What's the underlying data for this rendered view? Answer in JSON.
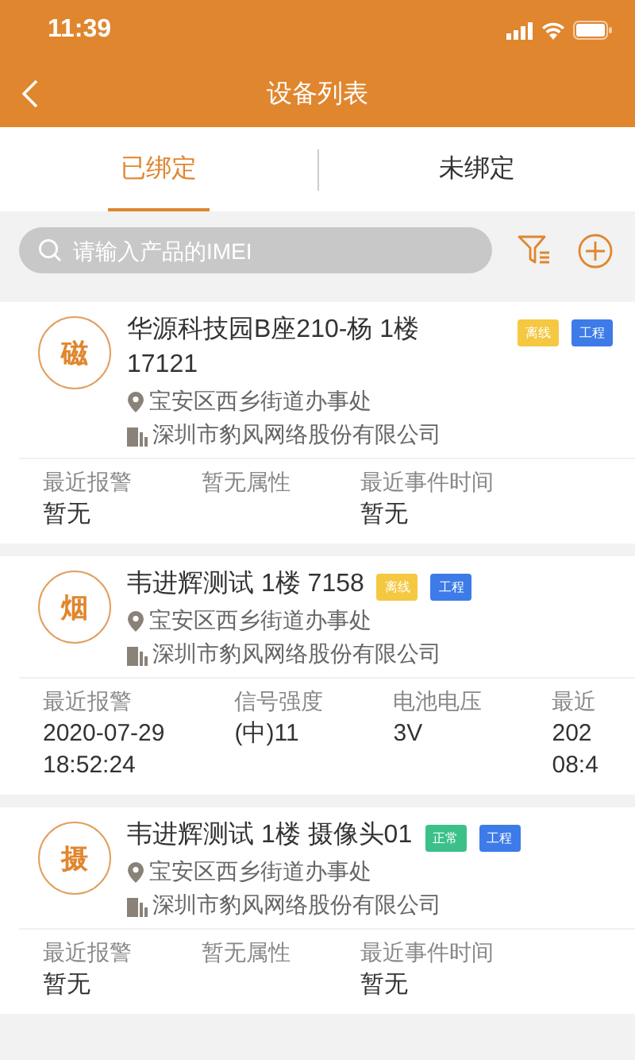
{
  "status_bar": {
    "time": "11:39"
  },
  "nav": {
    "title": "设备列表"
  },
  "tabs": [
    {
      "label": "已绑定",
      "selected": true
    },
    {
      "label": "未绑定",
      "selected": false
    }
  ],
  "search": {
    "placeholder": "请输入产品的IMEI"
  },
  "devices": [
    {
      "avatar": "磁",
      "name": "华源科技园B座210-杨 1楼 17121",
      "tags": [
        {
          "label": "离线",
          "color": "#f5c842"
        },
        {
          "label": "工程",
          "color": "#3d7be8"
        }
      ],
      "address": "宝安区西乡街道办事处",
      "company": "深圳市豹风网络股份有限公司",
      "stats": [
        {
          "label": "最近报警",
          "value": [
            "暂无"
          ]
        },
        {
          "label": "暂无属性"
        },
        {
          "label": "最近事件时间",
          "value": [
            "暂无"
          ]
        }
      ]
    },
    {
      "avatar": "烟",
      "name": "韦进辉测试 1楼 7158",
      "tags": [
        {
          "label": "离线",
          "color": "#f5c842"
        },
        {
          "label": "工程",
          "color": "#3d7be8"
        }
      ],
      "address": "宝安区西乡街道办事处",
      "company": "深圳市豹风网络股份有限公司",
      "stats": [
        {
          "label": "最近报警",
          "value": [
            "2020-07-29",
            "18:52:24"
          ]
        },
        {
          "label": "信号强度",
          "value": [
            "(中)11"
          ]
        },
        {
          "label": "电池电压",
          "value": [
            "3V"
          ]
        },
        {
          "label": "最近",
          "value": [
            "202",
            "08:4"
          ]
        }
      ]
    },
    {
      "avatar": "摄",
      "name": "韦进辉测试 1楼 摄像头01",
      "tags": [
        {
          "label": "正常",
          "color": "#3cc08a"
        },
        {
          "label": "工程",
          "color": "#3d7be8"
        }
      ],
      "address": "宝安区西乡街道办事处",
      "company": "深圳市豹风网络股份有限公司",
      "stats": [
        {
          "label": "最近报警",
          "value": [
            "暂无"
          ]
        },
        {
          "label": "暂无属性"
        },
        {
          "label": "最近事件时间",
          "value": [
            "暂无"
          ]
        }
      ]
    }
  ]
}
